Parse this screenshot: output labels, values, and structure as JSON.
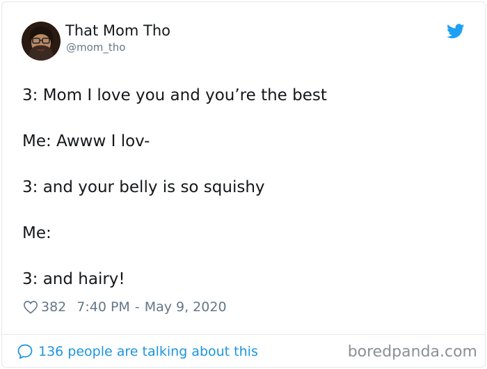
{
  "author": {
    "display_name": "That Mom Tho",
    "handle": "@mom_tho",
    "avatar": "profile-photo"
  },
  "brand_icon": "twitter-bird-icon",
  "tweet": {
    "lines": [
      "3: Mom I love you and you’re the best",
      "Me: Awww I lov-",
      "3: and your belly is so squishy",
      "Me:",
      "3: and hairy!"
    ]
  },
  "meta": {
    "likes": "382",
    "time": "7:40 PM",
    "separator": "-",
    "date": "May 9, 2020"
  },
  "footer": {
    "talking_text": "136 people are talking about this"
  },
  "watermark": "boredpanda.com",
  "colors": {
    "accent": "#1da1f2",
    "link": "#1b95e0",
    "text": "#14171a",
    "muted": "#657786",
    "border": "#e1e8ed"
  }
}
